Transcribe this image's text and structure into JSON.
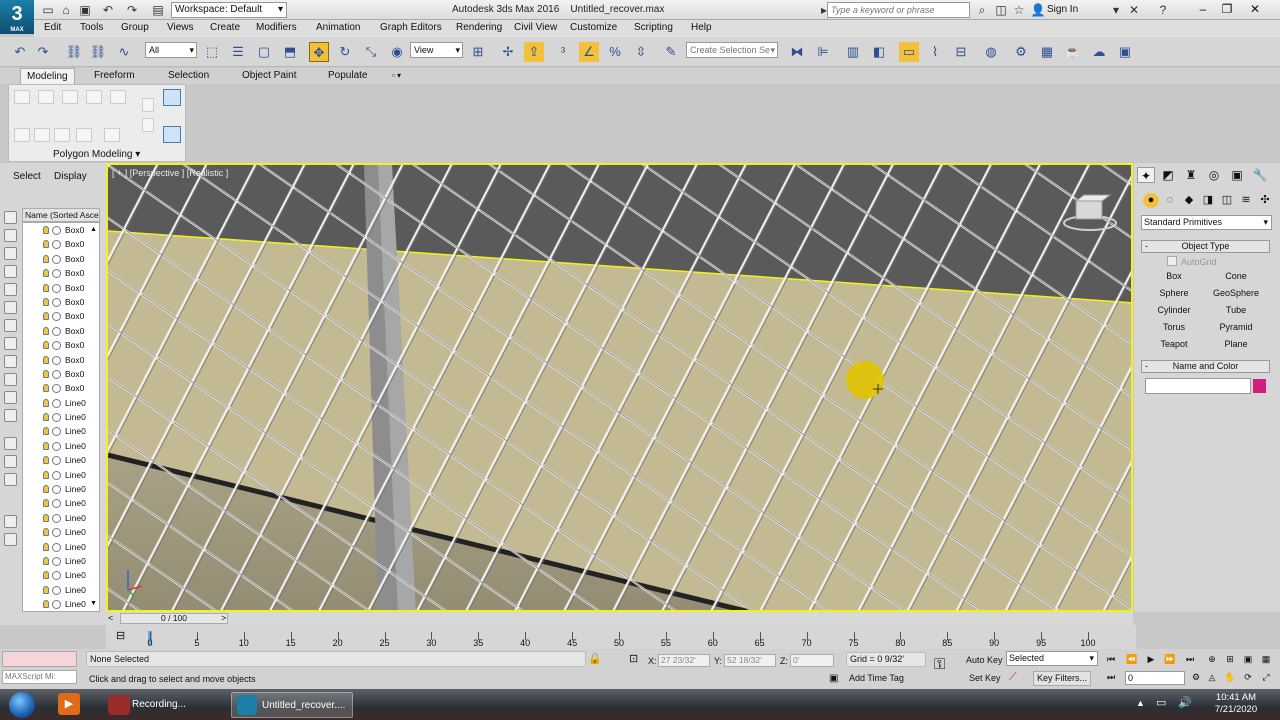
{
  "app": {
    "logo_text": "MAX",
    "title": "Autodesk 3ds Max 2016",
    "document": "Untitled_recover.max",
    "workspace": "Workspace: Default",
    "search_placeholder": "Type a keyword or phrase",
    "sign_in": "Sign In"
  },
  "menus": [
    "Edit",
    "Tools",
    "Group",
    "Views",
    "Create",
    "Modifiers",
    "Animation",
    "Graph Editors",
    "Rendering",
    "Civil View",
    "Customize",
    "Scripting",
    "Help"
  ],
  "toolbar": {
    "selection_filter": "All",
    "ref_coord": "View",
    "named_selection_placeholder": "Create Selection Se"
  },
  "ribbon": {
    "tabs": [
      "Modeling",
      "Freeform",
      "Selection",
      "Object Paint",
      "Populate"
    ],
    "panel_label": "Polygon Modeling ▾"
  },
  "scene_explorer": {
    "tabs": [
      "Select",
      "Display"
    ],
    "column_header": "Name (Sorted Ascending)",
    "items": [
      "Box0",
      "Box0",
      "Box0",
      "Box0",
      "Box0",
      "Box0",
      "Box0",
      "Box0",
      "Box0",
      "Box0",
      "Box0",
      "Box0",
      "Line0",
      "Line0",
      "Line0",
      "Line0",
      "Line0",
      "Line0",
      "Line0",
      "Line0",
      "Line0",
      "Line0",
      "Line0",
      "Line0",
      "Line0",
      "Line0",
      "Line0"
    ]
  },
  "viewport": {
    "label": "[ + ] [Perspective ] [Realistic ]",
    "border_color": "#f2f21a"
  },
  "command_panel": {
    "category": "Standard Primitives",
    "object_type_title": "Object Type",
    "autogrid": "AutoGrid",
    "buttons": [
      "Box",
      "Cone",
      "Sphere",
      "GeoSphere",
      "Cylinder",
      "Tube",
      "Torus",
      "Pyramid",
      "Teapot",
      "Plane"
    ],
    "name_color_title": "Name and Color",
    "object_color": "#d01e7a"
  },
  "timeline": {
    "frame_display": "0 / 100",
    "ticks": [
      "0",
      "5",
      "10",
      "15",
      "20",
      "25",
      "30",
      "35",
      "40",
      "45",
      "50",
      "55",
      "60",
      "65",
      "70",
      "75",
      "80",
      "85",
      "90",
      "95",
      "100"
    ]
  },
  "status": {
    "maxscript": "MAXScript Mi:",
    "selection": "None Selected",
    "prompt": "Click and drag to select and move objects",
    "x_label": "X:",
    "x_value": "27 23/32'",
    "y_label": "Y:",
    "y_value": "52 18/32'",
    "z_label": "Z:",
    "z_value": "0'",
    "grid": "Grid = 0 9/32'",
    "add_time_tag": "Add Time Tag",
    "auto_key": "Auto Key",
    "set_key": "Set Key",
    "key_mode": "Selected",
    "key_filters": "Key Filters...",
    "current_frame": "0"
  },
  "taskbar": {
    "apps": [
      "Recording...",
      "Untitled_recover...."
    ],
    "time": "10:41 AM",
    "date": "7/21/2020"
  }
}
